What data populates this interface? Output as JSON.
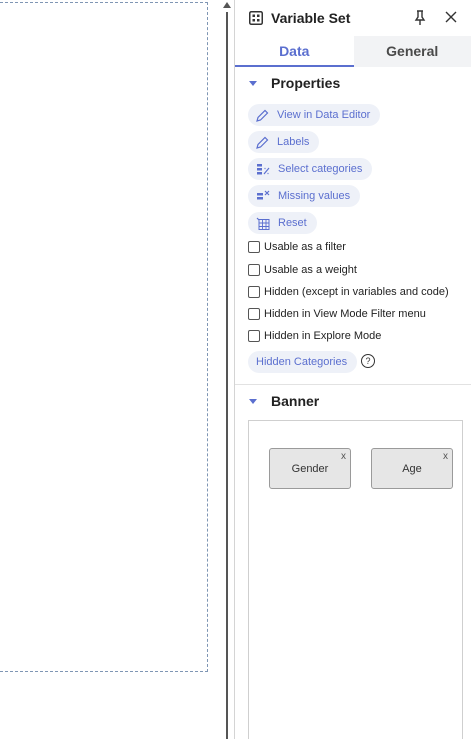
{
  "panel": {
    "title": "Variable Set",
    "tabs": [
      {
        "label": "Data",
        "active": true
      },
      {
        "label": "General",
        "active": false
      }
    ]
  },
  "properties": {
    "title": "Properties",
    "buttons": [
      {
        "label": "View in Data Editor",
        "icon": "pencil-icon"
      },
      {
        "label": "Labels",
        "icon": "pencil-icon"
      },
      {
        "label": "Select categories",
        "icon": "select-categories-icon"
      },
      {
        "label": "Missing values",
        "icon": "missing-values-icon"
      },
      {
        "label": "Reset",
        "icon": "reset-table-icon"
      }
    ],
    "checkboxes": [
      {
        "label": "Usable as a filter",
        "checked": false
      },
      {
        "label": "Usable as a weight",
        "checked": false
      },
      {
        "label": "Hidden (except in variables and code)",
        "checked": false
      },
      {
        "label": "Hidden in View Mode Filter menu",
        "checked": false
      },
      {
        "label": "Hidden in Explore Mode",
        "checked": false
      }
    ],
    "hidden_categories_label": "Hidden Categories",
    "help_symbol": "?"
  },
  "banner": {
    "title": "Banner",
    "items": [
      {
        "label": "Gender",
        "remove": "x"
      },
      {
        "label": "Age",
        "remove": "x"
      }
    ]
  },
  "colors": {
    "accent": "#5b6fcf",
    "chip_bg": "#eef1f8",
    "card_bg": "#e6e6e6",
    "dashed_border": "#7f96b4"
  }
}
